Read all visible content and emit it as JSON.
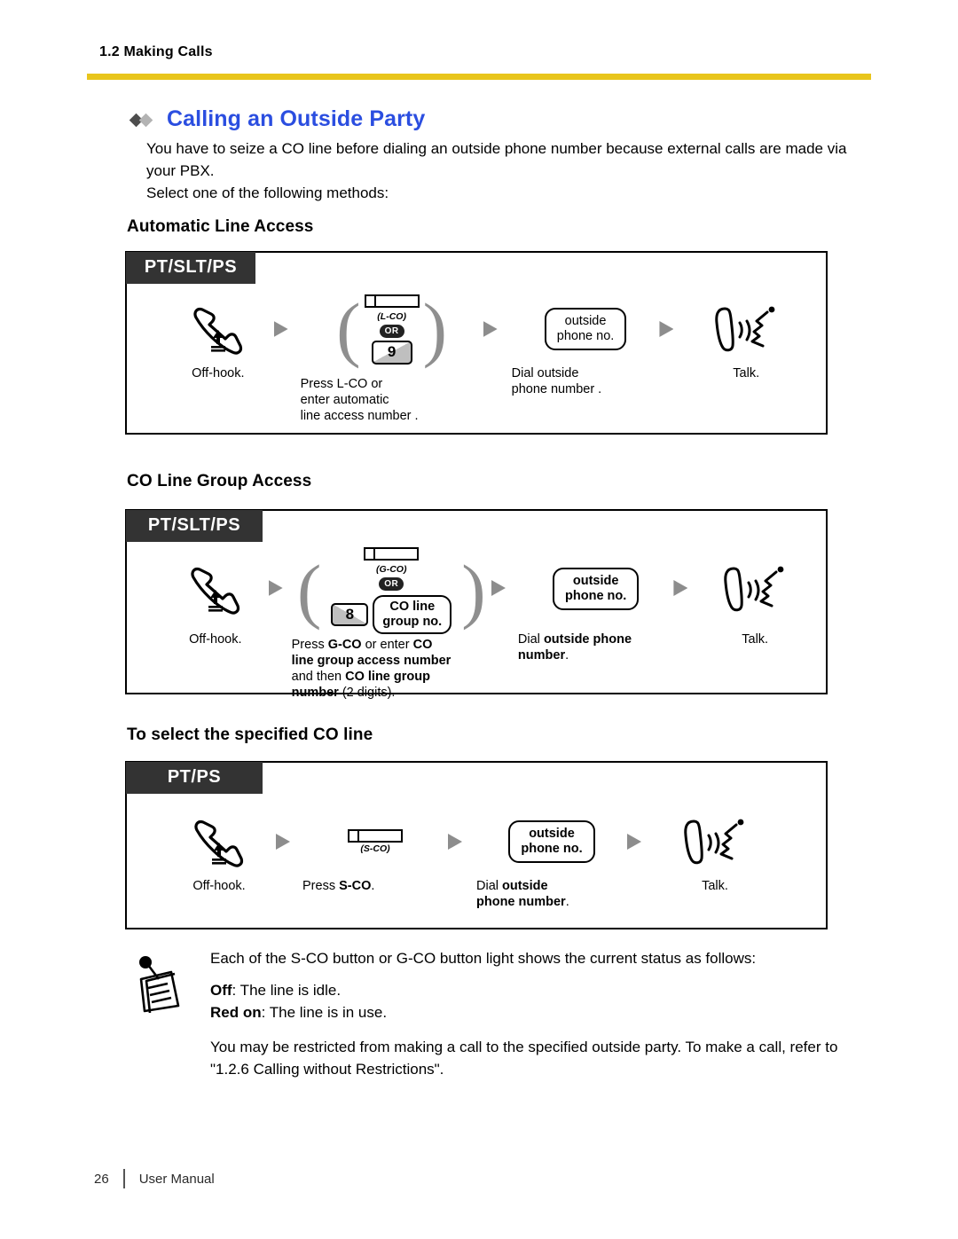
{
  "header": {
    "section": "1.2 Making Calls",
    "rule_color": "#e8c51c"
  },
  "title": {
    "text": "Calling an Outside Party",
    "color": "#2b4ee0"
  },
  "intro": {
    "paragraph": "You have to seize a CO line before dialing an outside phone number because external calls are made via your PBX.",
    "line2": "Select one of the following methods:"
  },
  "sections": [
    {
      "heading": "Automatic Line Access",
      "device_tag": "PT/SLT/PS",
      "steps": [
        {
          "caption": "Off-hook.",
          "art": "offhook-handset"
        },
        {
          "caption_lines": [
            "Press L-CO or",
            "enter automatic",
            "line access number  ."
          ],
          "art": "key-or-dial",
          "key_label": "(L-CO)",
          "or_label": "OR",
          "dial_digit": "9"
        },
        {
          "caption_lines": [
            "Dial outside",
            "phone number  ."
          ],
          "art": "bubble",
          "bubble_lines": [
            "outside",
            "phone no."
          ]
        },
        {
          "caption": "Talk.",
          "art": "talk-icon"
        }
      ]
    },
    {
      "heading": "CO Line Group Access",
      "device_tag": "PT/SLT/PS",
      "steps": [
        {
          "caption": "Off-hook.",
          "art": "offhook-handset"
        },
        {
          "caption_rich": [
            [
              {
                "t": "Press ",
                "b": false
              },
              {
                "t": "G-CO",
                "b": true
              },
              {
                "t": " or enter ",
                "b": false
              },
              {
                "t": "CO",
                "b": true
              }
            ],
            [
              {
                "t": "line group access number",
                "b": true
              }
            ],
            [
              {
                "t": "and then ",
                "b": false
              },
              {
                "t": "CO line group",
                "b": true
              }
            ],
            [
              {
                "t": "number",
                "b": true
              },
              {
                "t": " (2 digits).",
                "b": false
              }
            ]
          ],
          "art": "key-or-dial-bubble",
          "key_label": "(G-CO)",
          "or_label": "OR",
          "dial_digit": "8",
          "bubble_lines": [
            "CO line",
            "group no."
          ]
        },
        {
          "caption_rich": [
            [
              {
                "t": "Dial ",
                "b": false
              },
              {
                "t": "outside phone",
                "b": true
              }
            ],
            [
              {
                "t": "number",
                "b": true
              },
              {
                "t": ".",
                "b": false
              }
            ]
          ],
          "art": "bubble",
          "bubble_lines": [
            "outside",
            "phone no."
          ]
        },
        {
          "caption": "Talk.",
          "art": "talk-icon"
        }
      ]
    },
    {
      "heading": "To select the specified CO line",
      "device_tag": "PT/PS",
      "steps": [
        {
          "caption": "Off-hook.",
          "art": "offhook-handset"
        },
        {
          "caption_rich": [
            [
              {
                "t": "Press ",
                "b": false
              },
              {
                "t": "S-CO",
                "b": true
              },
              {
                "t": ".",
                "b": false
              }
            ]
          ],
          "art": "key-only",
          "key_label": "(S-CO)"
        },
        {
          "caption_rich": [
            [
              {
                "t": "Dial ",
                "b": false
              },
              {
                "t": "outside",
                "b": true
              }
            ],
            [
              {
                "t": "phone number",
                "b": true
              },
              {
                "t": ".",
                "b": false
              }
            ]
          ],
          "art": "bubble",
          "bubble_lines": [
            "outside",
            "phone no."
          ]
        },
        {
          "caption": "Talk.",
          "art": "talk-icon"
        }
      ]
    }
  ],
  "note": {
    "icon": "memo-note-icon",
    "line1": "Each of the S-CO button or G-CO button light shows the current status as follows:",
    "status_off_label": "Off",
    "status_off_text": ": The line is idle.",
    "status_redon_label": "Red on",
    "status_redon_text": ": The line is in use.",
    "line4": "You may be restricted from making a call to the specified outside party. To make a call, refer to \"1.2.6 Calling without Restrictions\"."
  },
  "footer": {
    "page_number": "26",
    "doc_label": "User Manual"
  }
}
